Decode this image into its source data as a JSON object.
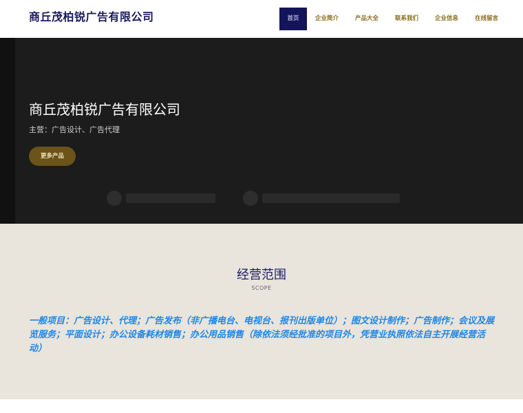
{
  "header": {
    "logo": "商丘茂柏锐广告有限公司",
    "nav": [
      {
        "label": "首页"
      },
      {
        "label": "企业简介"
      },
      {
        "label": "产品大全"
      },
      {
        "label": "联系我们"
      },
      {
        "label": "企业信息"
      },
      {
        "label": "在线留言"
      }
    ]
  },
  "hero": {
    "title": "商丘茂柏锐广告有限公司",
    "subtitle": "主营：广告设计、广告代理",
    "button": "更多产品"
  },
  "scope": {
    "title": "经营范围",
    "subtitle": "SCOPE",
    "text": "一般项目：广告设计、代理；广告发布（非广播电台、电视台、报刊出版单位）；图文设计制作；广告制作；会议及展览服务；平面设计；办公设备耗材销售；办公用品销售（除依法须经批准的项目外，凭营业执照依法自主开展经营活动）"
  },
  "colors": {
    "brand_navy": "#14145a",
    "accent_gold": "#8a6d1f",
    "button_brown": "#6b5319",
    "scope_bg": "#e9e4dc",
    "scope_text_blue": "#1e87e6"
  }
}
